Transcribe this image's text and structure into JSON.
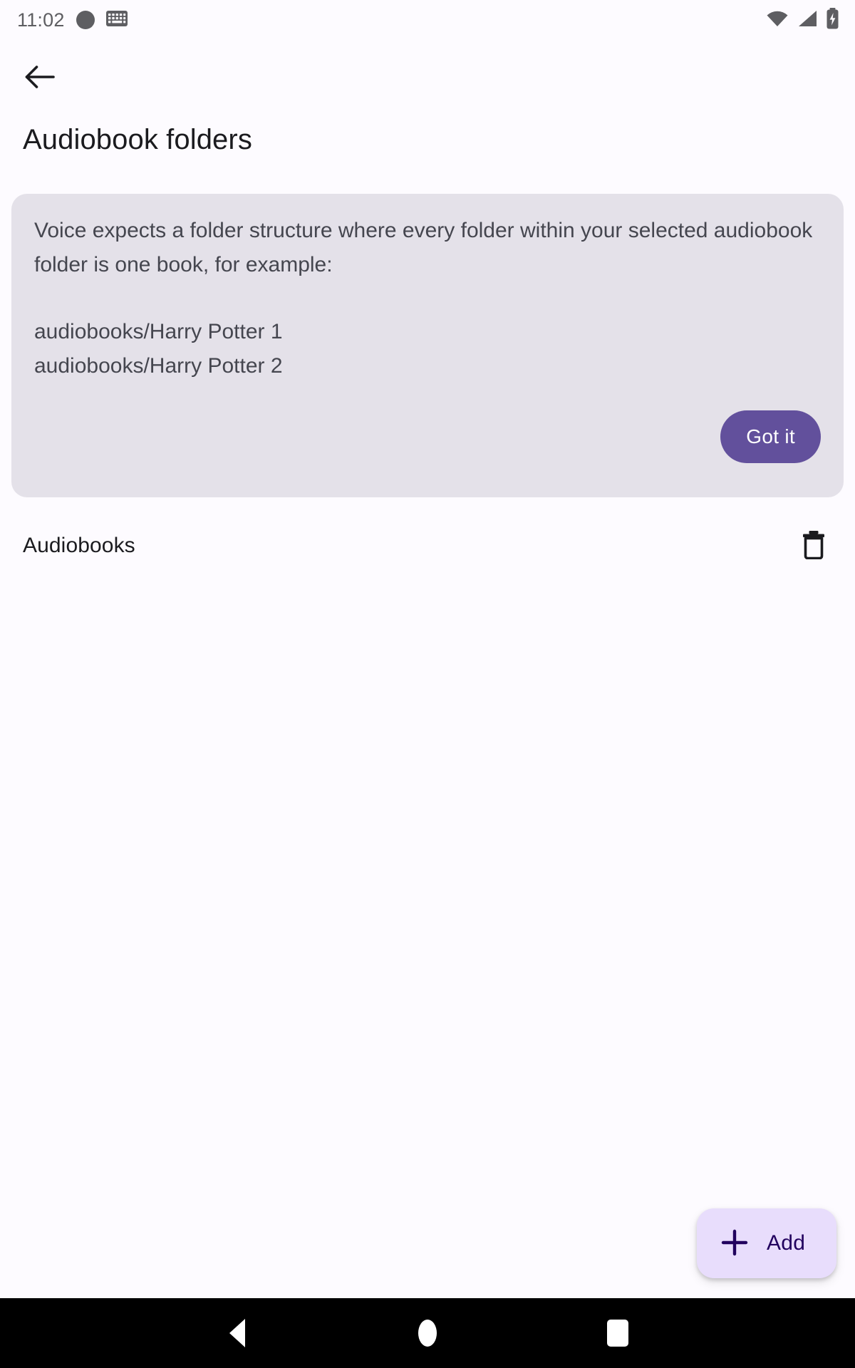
{
  "status_bar": {
    "clock": "11:02",
    "icons_left": [
      "circle-icon",
      "keyboard-icon"
    ],
    "icons_right": [
      "wifi-icon",
      "cellular-signal-icon",
      "battery-charging-icon"
    ]
  },
  "app_bar": {
    "back_icon": "arrow-left-icon",
    "title": "Audiobook folders"
  },
  "info_card": {
    "paragraph": "Voice expects a folder structure where every folder within your selected audiobook folder is one book, for example:",
    "examples": [
      "audiobooks/Harry Potter 1",
      "audiobooks/Harry Potter 2"
    ],
    "got_it_label": "Got it",
    "accent_color": "#62509c",
    "background_color": "#e4e1e9"
  },
  "folders": [
    {
      "name": "Audiobooks",
      "delete_icon": "trash-icon"
    }
  ],
  "fab": {
    "icon": "plus-icon",
    "label": "Add",
    "background_color": "#e8ddfc",
    "text_color": "#21005e"
  },
  "nav_bar": {
    "back_label": "Back",
    "home_label": "Home",
    "recents_label": "Recents"
  }
}
